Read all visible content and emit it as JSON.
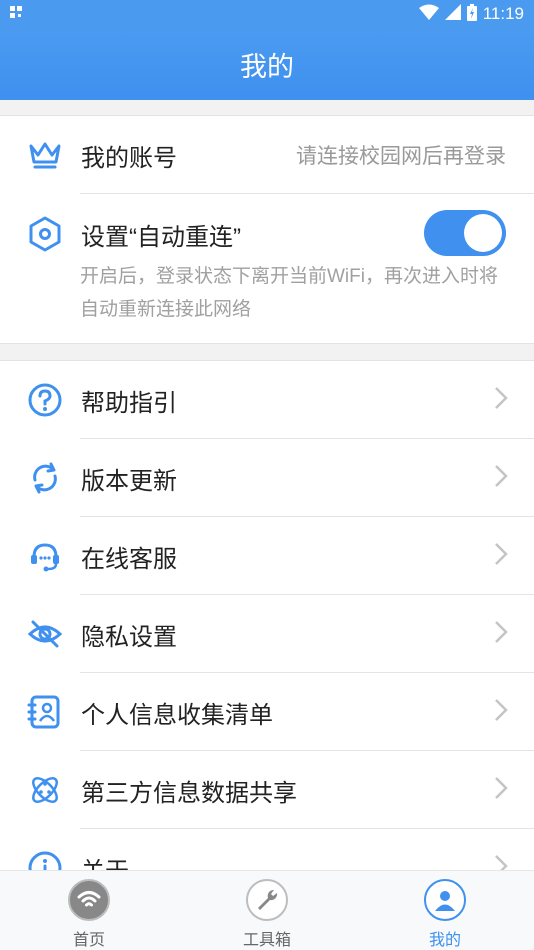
{
  "status_bar": {
    "time": "11:19"
  },
  "app_bar": {
    "title": "我的"
  },
  "account": {
    "label": "我的账号",
    "value": "请连接校园网后再登录"
  },
  "auto_reconnect": {
    "label": "设置“自动重连”",
    "description": "开启后，登录状态下离开当前WiFi，再次进入时将自动重新连接此网络",
    "enabled": true
  },
  "menu": [
    {
      "label": "帮助指引",
      "icon": "question-icon"
    },
    {
      "label": "版本更新",
      "icon": "refresh-icon"
    },
    {
      "label": "在线客服",
      "icon": "headset-icon"
    },
    {
      "label": "隐私设置",
      "icon": "eye-off-icon"
    },
    {
      "label": "个人信息收集清单",
      "icon": "contact-card-icon"
    },
    {
      "label": "第三方信息数据共享",
      "icon": "share-orbit-icon"
    },
    {
      "label": "关于",
      "icon": "info-icon"
    }
  ],
  "tabs": [
    {
      "label": "首页",
      "icon": "wifi-icon",
      "active": false
    },
    {
      "label": "工具箱",
      "icon": "wrench-icon",
      "active": false
    },
    {
      "label": "我的",
      "icon": "user-icon",
      "active": true
    }
  ],
  "colors": {
    "accent": "#3f90ef",
    "divider": "#e4e4e4",
    "muted_text": "#a0a0a0"
  }
}
